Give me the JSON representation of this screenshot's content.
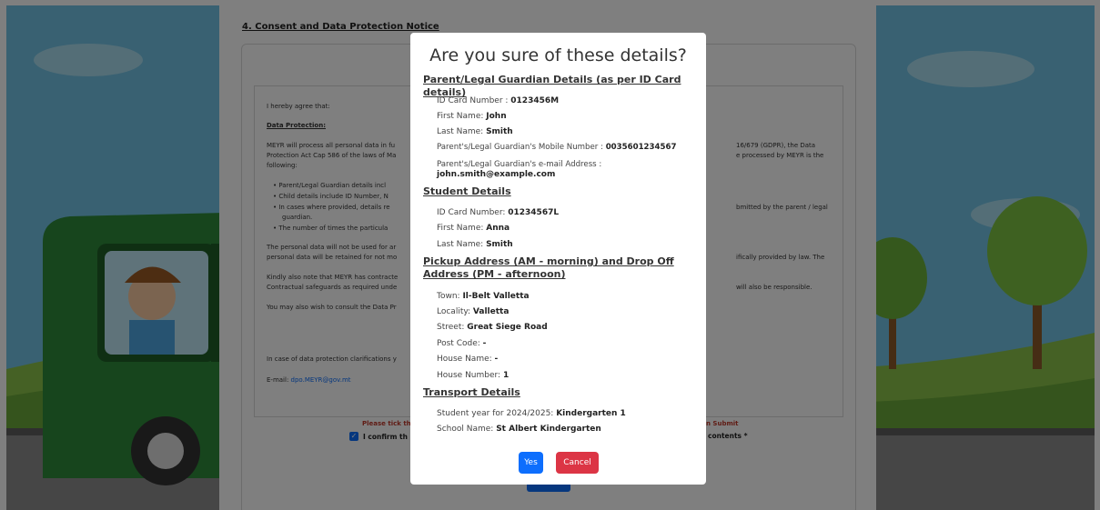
{
  "page": {
    "section_heading": "4. Consent and Data Protection Notice",
    "consent": {
      "intro": "I hereby agree that:",
      "data_protection_heading": "Data Protection:",
      "para1_left_l1": "MEYR will process all personal data in fu",
      "para1_left_l2": "Protection Act Cap 586 of the laws of Ma",
      "para1_left_l3": "following:",
      "para1_right_l1": "16/679 (GDPR), the Data",
      "para1_right_l2": "e processed by MEYR is the",
      "bullet1": "Parent/Legal Guardian details incl",
      "bullet2": "Child details include ID Number, N",
      "bullet3_l1": "In cases where provided, details re",
      "bullet3_l2": "guardian.",
      "bullet4": "The number of times the particula",
      "bullet3_right": "bmitted by the parent / legal",
      "para2_left_l1": "The personal data will not be used for ar",
      "para2_left_l2": "personal data will be retained for not mo",
      "para2_right": "ifically provided by law. The",
      "para3_left_l1": "Kindly also note that MEYR has contracte",
      "para3_left_l2": "Contractual safeguards as required unde",
      "para3_right": "will also be responsible.",
      "para4_left": "You may also wish to consult the Data Pr",
      "para5_left": "In case of data protection clarifications y",
      "email_label": "E-mail:",
      "email_value": "dpo.MEYR@gov.mt"
    },
    "warning_left": "Please tick the",
    "warning_right": "n Submit",
    "confirm_left": "I confirm th",
    "confirm_right": "contents *",
    "confirm_checked": "✓"
  },
  "modal": {
    "title": "Are you sure of these details?",
    "parent_heading": "Parent/Legal Guardian Details (as per ID Card details)",
    "parent": {
      "id_label": "ID Card Number : ",
      "id_value": "0123456M",
      "first_label": "First Name: ",
      "first_value": "John",
      "last_label": "Last Name: ",
      "last_value": "Smith",
      "mobile_label": "Parent's/Legal Guardian's Mobile Number : ",
      "mobile_value": "0035601234567",
      "email_label": "Parent's/Legal Guardian's e-mail Address :",
      "email_value": "john.smith@example.com"
    },
    "student_heading": "Student Details",
    "student": {
      "id_label": "ID Card Number: ",
      "id_value": "01234567L",
      "first_label": "First Name: ",
      "first_value": "Anna",
      "last_label": "Last Name: ",
      "last_value": "Smith"
    },
    "pickup_heading": "Pickup Address (AM - morning) and Drop Off Address (PM - afternoon)",
    "pickup": {
      "town_label": "Town: ",
      "town_value": "Il-Belt Valletta",
      "locality_label": "Locality: ",
      "locality_value": "Valletta",
      "street_label": "Street: ",
      "street_value": "Great Siege Road",
      "postcode_label": "Post Code: ",
      "postcode_value": "-",
      "housename_label": "House Name: ",
      "housename_value": "-",
      "housenumber_label": "House Number: ",
      "housenumber_value": "1"
    },
    "transport_heading": "Transport Details",
    "transport": {
      "year_label": "Student year for 2024/2025: ",
      "year_value": "Kindergarten 1",
      "school_label": "School Name: ",
      "school_value": "St Albert Kindergarten"
    },
    "yes_label": "Yes",
    "cancel_label": "Cancel"
  },
  "colors": {
    "primary": "#0d6efd",
    "danger": "#dc3545",
    "warning_text": "#c0392b"
  }
}
